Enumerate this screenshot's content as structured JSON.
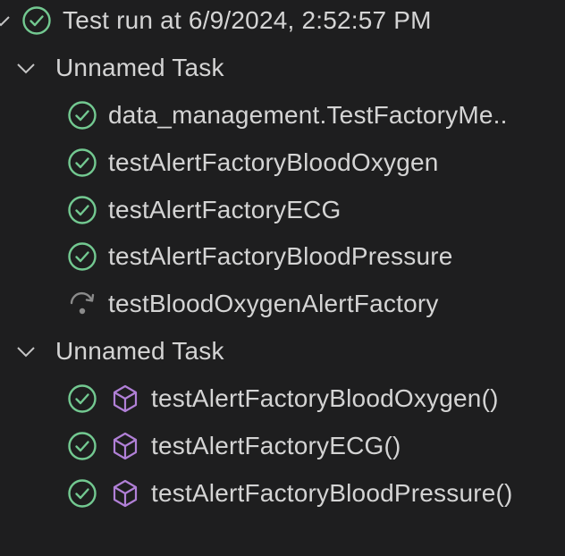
{
  "colors": {
    "background": "#1e1e1f",
    "text": "#d4d4d4",
    "passed": "#73c991",
    "skipped": "#8b8b8b",
    "method_icon": "#b180d7",
    "chevron": "#c5c5c5"
  },
  "test_run": {
    "label": "Test run at 6/9/2024, 2:52:57 PM",
    "expanded_icon": "chevron-down-icon",
    "status_icon": "pass-circle-icon"
  },
  "tasks": [
    {
      "label": "Unnamed Task",
      "expanded_icon": "chevron-down-icon",
      "tests": [
        {
          "label": "data_management.TestFactoryMe..",
          "status": "passed",
          "status_icon": "pass-circle-icon"
        },
        {
          "label": "testAlertFactoryBloodOxygen",
          "status": "passed",
          "status_icon": "pass-circle-icon"
        },
        {
          "label": "testAlertFactoryECG",
          "status": "passed",
          "status_icon": "pass-circle-icon"
        },
        {
          "label": "testAlertFactoryBloodPressure",
          "status": "passed",
          "status_icon": "pass-circle-icon"
        },
        {
          "label": "testBloodOxygenAlertFactory",
          "status": "skipped",
          "status_icon": "skip-arrow-icon"
        }
      ]
    },
    {
      "label": "Unnamed Task",
      "expanded_icon": "chevron-down-icon",
      "tests": [
        {
          "label": "testAlertFactoryBloodOxygen()",
          "status": "passed",
          "status_icon": "pass-circle-icon",
          "kind_icon": "method-cube-icon"
        },
        {
          "label": "testAlertFactoryECG()",
          "status": "passed",
          "status_icon": "pass-circle-icon",
          "kind_icon": "method-cube-icon"
        },
        {
          "label": "testAlertFactoryBloodPressure()",
          "status": "passed",
          "status_icon": "pass-circle-icon",
          "kind_icon": "method-cube-icon"
        }
      ]
    }
  ]
}
